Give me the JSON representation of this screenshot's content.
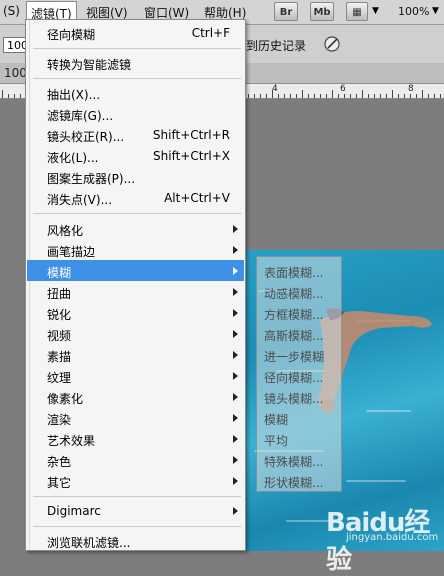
{
  "menubar": {
    "items": [
      "(S)",
      "滤镜(T)",
      "视图(V)",
      "窗口(W)",
      "帮助(H)"
    ],
    "toolbar_icons": [
      "Br",
      "Mb"
    ],
    "zoom": "100%"
  },
  "options_bar": {
    "field_value": "100",
    "history_text": "到历史记录"
  },
  "tab": {
    "text": "100"
  },
  "ruler": {
    "labels": [
      "4",
      "6",
      "8"
    ]
  },
  "filter_menu": {
    "items": [
      {
        "label": "径向模糊",
        "shortcut": "Ctrl+F"
      },
      {
        "label": "转换为智能滤镜"
      },
      {
        "label": "抽出(X)..."
      },
      {
        "label": "滤镜库(G)..."
      },
      {
        "label": "镜头校正(R)...",
        "shortcut": "Shift+Ctrl+R"
      },
      {
        "label": "液化(L)...",
        "shortcut": "Shift+Ctrl+X"
      },
      {
        "label": "图案生成器(P)..."
      },
      {
        "label": "消失点(V)...",
        "shortcut": "Alt+Ctrl+V"
      },
      {
        "label": "风格化"
      },
      {
        "label": "画笔描边"
      },
      {
        "label": "模糊"
      },
      {
        "label": "扭曲"
      },
      {
        "label": "锐化"
      },
      {
        "label": "视频"
      },
      {
        "label": "素描"
      },
      {
        "label": "纹理"
      },
      {
        "label": "像素化"
      },
      {
        "label": "渲染"
      },
      {
        "label": "艺术效果"
      },
      {
        "label": "杂色"
      },
      {
        "label": "其它"
      },
      {
        "label": "Digimarc"
      },
      {
        "label": "浏览联机滤镜..."
      }
    ]
  },
  "blur_submenu": {
    "items": [
      "表面模糊...",
      "动感模糊...",
      "方框模糊...",
      "高斯模糊...",
      "进一步模糊",
      "径向模糊...",
      "镜头模糊...",
      "模糊",
      "平均",
      "特殊模糊...",
      "形状模糊..."
    ]
  },
  "watermark": {
    "brand": "Baidu经验",
    "url": "jingyan.baidu.com"
  },
  "colors": {
    "highlight": "#3d8fe8",
    "menu_bg": "#f5f5f5",
    "water": "#1c8db5"
  }
}
